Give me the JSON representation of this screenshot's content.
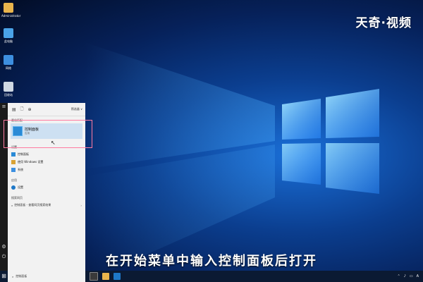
{
  "watermark": {
    "text": "天奇·视频"
  },
  "caption": {
    "text": "在开始菜单中输入控制面板后打开"
  },
  "desktop": {
    "icons": [
      {
        "name": "folder-icon",
        "label": "Administrator",
        "color": "#e9b44c"
      },
      {
        "name": "computer-icon",
        "label": "此电脑",
        "color": "#4aa3e8"
      },
      {
        "name": "network-icon",
        "label": "网络",
        "color": "#3d8fe0"
      },
      {
        "name": "recycle-bin-icon",
        "label": "回收站",
        "color": "#cfd8e3"
      }
    ]
  },
  "start_panel": {
    "tabs": [
      "▤",
      "🗋",
      "⊕"
    ],
    "filter_label": "筛选器 ∨",
    "best_match_header": "最佳匹配",
    "best_match": {
      "title": "控制面板",
      "subtitle": "应用"
    },
    "settings_header": "设置",
    "settings_items": [
      "控制面板",
      "使用 Windows 设置",
      "系统"
    ],
    "apps_header": "应用",
    "apps_items": [
      "设置"
    ],
    "search_header": "搜索网页",
    "search_item": "控制面板 - 查看网页搜索结果",
    "arrow": "›"
  },
  "taskbar": {
    "start_glyph": "⊞",
    "search_text": "控制面板",
    "search_glyph": "⌕",
    "tray_glyphs": [
      "⌃",
      "♪",
      "▭",
      "A"
    ]
  },
  "colors": {
    "accent": "#2a8ad6",
    "highlight_border": "#ff7aa0",
    "taskbar": "#0b1a33"
  }
}
